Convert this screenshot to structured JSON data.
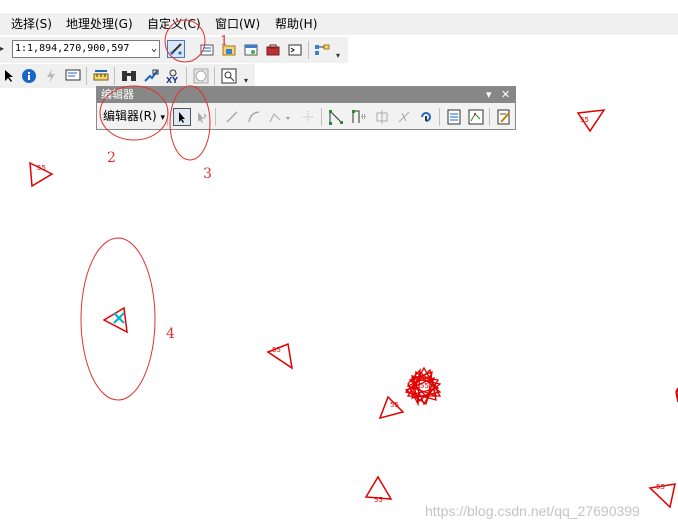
{
  "menu": [
    {
      "label": "选择(S)"
    },
    {
      "label": "地理处理(G)"
    },
    {
      "label": "自定义(C)"
    },
    {
      "label": "窗口(W)"
    },
    {
      "label": "帮助(H)"
    }
  ],
  "toolbar": {
    "scale_value": "1:1,894,270,900,597"
  },
  "editor": {
    "title": "编辑器",
    "menu_label": "编辑器(R)",
    "pin_icon": "▾",
    "close_icon": "✕"
  },
  "annotations": [
    "1",
    "2",
    "3",
    "4"
  ],
  "map": {
    "feature_label": "55"
  },
  "watermark": "https://blog.csdn.net/qq_27690399",
  "colors": {
    "annotation": "#e0322e",
    "feature": "#e00000",
    "selected": "#00b0d0",
    "title_bar": "#878787"
  }
}
